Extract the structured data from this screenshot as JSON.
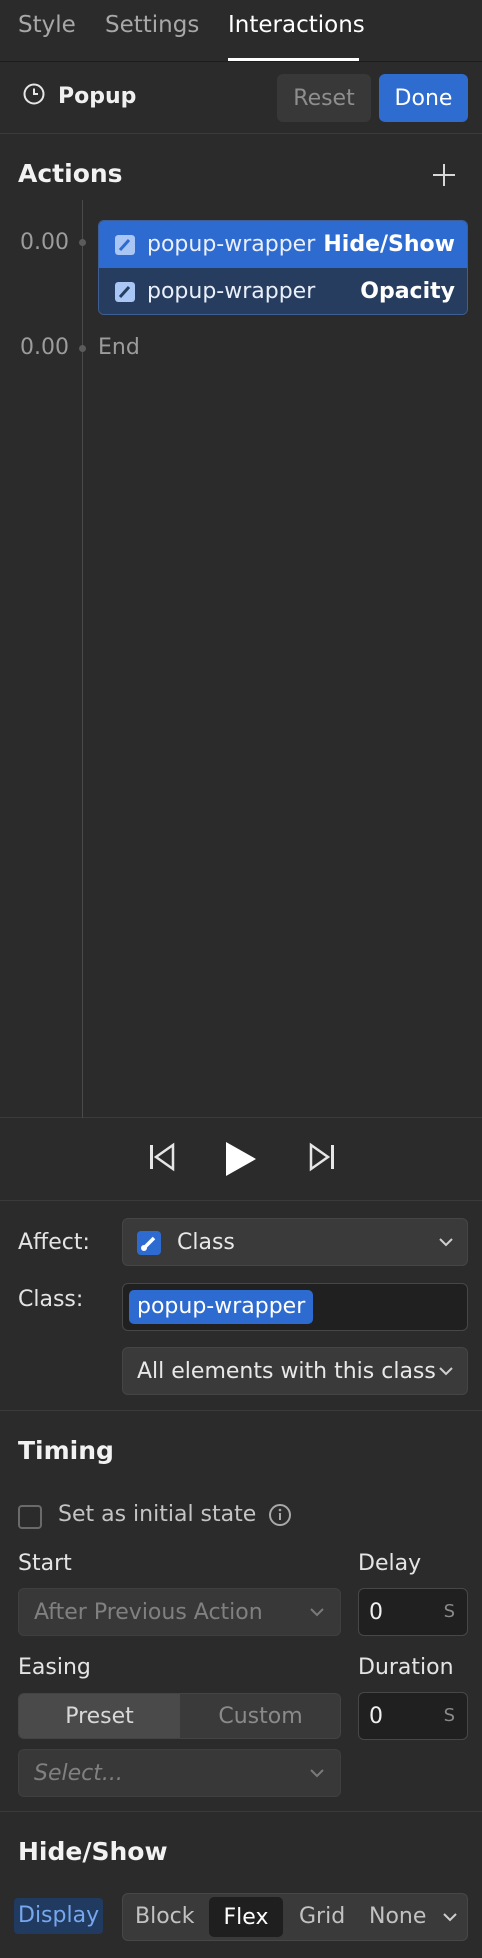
{
  "tabs": [
    {
      "label": "Style"
    },
    {
      "label": "Settings"
    },
    {
      "label": "Interactions"
    }
  ],
  "header": {
    "title": "Popup",
    "reset_label": "Reset",
    "done_label": "Done",
    "icon": "clock-icon"
  },
  "actions": {
    "title": "Actions",
    "start_time": "0.00",
    "end_time": "0.00",
    "end_label": "End",
    "items": [
      {
        "target": "popup-wrapper",
        "type": "Hide/Show",
        "selected": true
      },
      {
        "target": "popup-wrapper",
        "type": "Opacity",
        "selected": false
      }
    ]
  },
  "affect": {
    "label": "Affect:",
    "value": "Class",
    "class_label": "Class:",
    "class_chip": "popup-wrapper",
    "scope_value": "All elements with this class"
  },
  "timing": {
    "title": "Timing",
    "initial_state_label": "Set as initial state",
    "start_label": "Start",
    "start_value": "After Previous Action",
    "delay_label": "Delay",
    "delay_value": "0",
    "delay_unit": "S",
    "easing_label": "Easing",
    "easing_preset": "Preset",
    "easing_custom": "Custom",
    "easing_placeholder": "Select...",
    "duration_label": "Duration",
    "duration_value": "0",
    "duration_unit": "S"
  },
  "hideshow": {
    "title": "Hide/Show",
    "display_label": "Display",
    "options": [
      "Block",
      "Flex",
      "Grid",
      "None"
    ],
    "selected": "Flex"
  },
  "colors": {
    "accent": "#2e6bd0",
    "background": "#2b2b2b"
  }
}
